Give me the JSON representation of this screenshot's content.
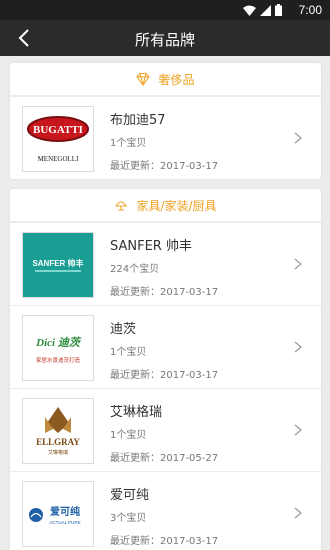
{
  "status_bar": {
    "time": "7:00"
  },
  "app_bar": {
    "title": "所有品牌"
  },
  "accent_color": "#f0a020",
  "sections": [
    {
      "title": "奢侈品",
      "icon": "diamond-icon",
      "brands": [
        {
          "name": "布加迪57",
          "count": "1个宝贝",
          "updated": "最近更新：2017-03-17",
          "logo_text": "BUGATTI",
          "logo_sub": "MENEGOLLI"
        }
      ]
    },
    {
      "title": "家具/家装/厨具",
      "icon": "lamp-icon",
      "brands": [
        {
          "name": "SANFER 帅丰",
          "count": "224个宝贝",
          "updated": "最近更新：2017-03-17",
          "logo_text": "SANFER 帅丰",
          "logo_sub": ""
        },
        {
          "name": "迪茨",
          "count": "1个宝贝",
          "updated": "最近更新：2017-03-17",
          "logo_text": "Dici 迪茨",
          "logo_sub": "家居水景迪茨打造"
        },
        {
          "name": "艾琳格瑞",
          "count": "1个宝贝",
          "updated": "最近更新：2017-05-27",
          "logo_text": "ELLGRAY",
          "logo_sub": "艾琳格瑞"
        },
        {
          "name": "爱可纯",
          "count": "3个宝贝",
          "updated": "最近更新：2017-03-17",
          "logo_text": "爱可纯",
          "logo_sub": "ACTUAL PURE"
        }
      ]
    }
  ]
}
